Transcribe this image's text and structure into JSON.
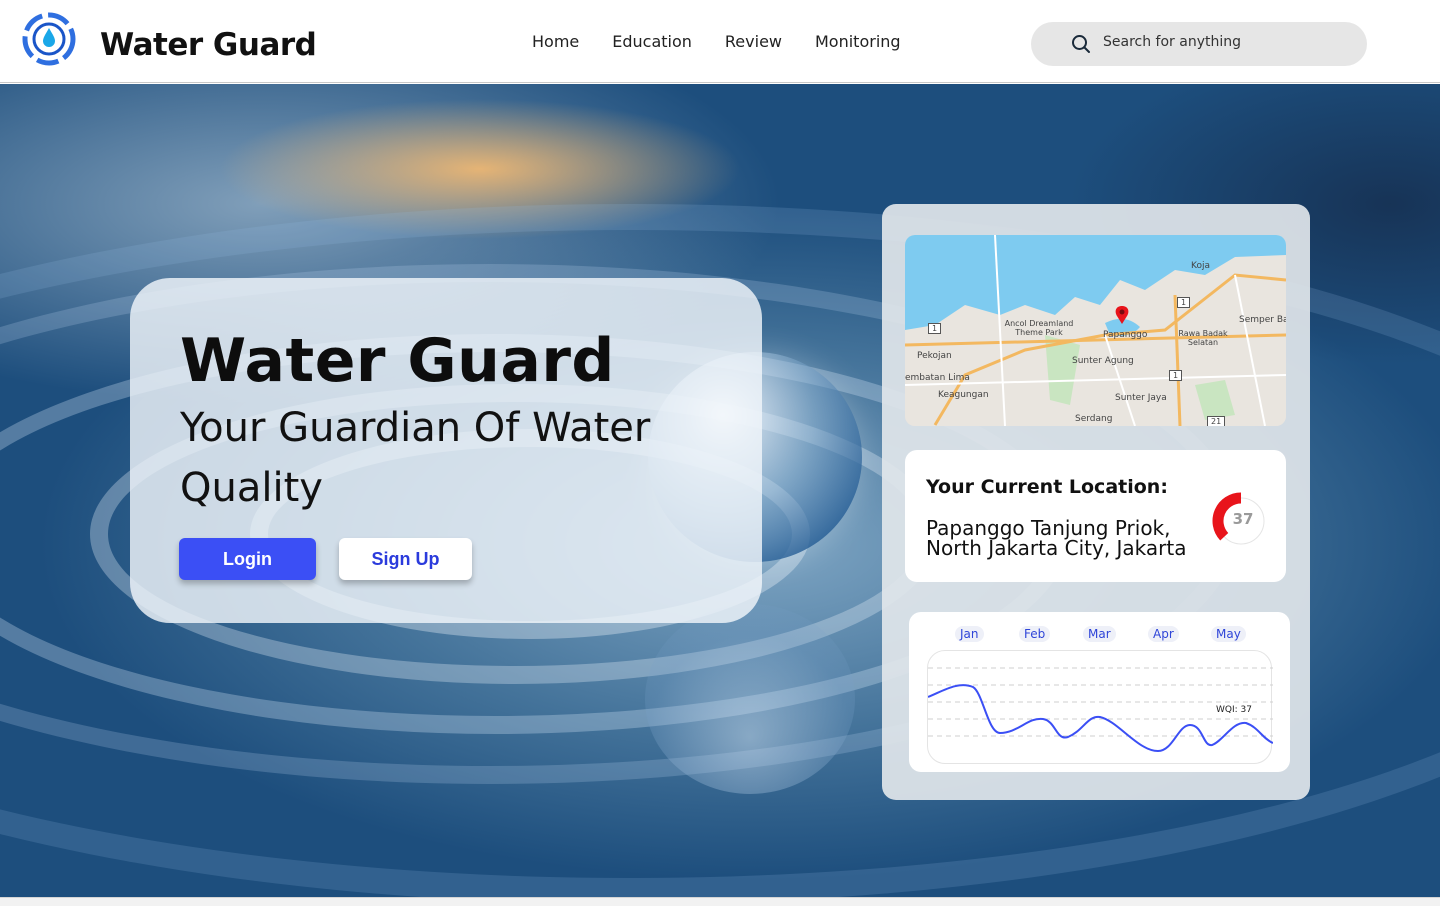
{
  "header": {
    "brand": "Water Guard",
    "nav": [
      {
        "label": "Home"
      },
      {
        "label": "Education"
      },
      {
        "label": "Review"
      },
      {
        "label": "Monitoring"
      }
    ],
    "search": {
      "placeholder": "Search for anything"
    }
  },
  "hero": {
    "title": "Water Guard",
    "subtitle": "Your Guardian Of Water Quality",
    "login_label": "Login",
    "signup_label": "Sign Up"
  },
  "panel": {
    "map": {
      "labels": [
        "Koja",
        "Semper Ba",
        "Ancol Dreamland Theme Park",
        "Papanggo",
        "Rawa Badak Selatan",
        "Pekojan",
        "Sunter Agung",
        "embatan Lima",
        "Keagungan",
        "Sunter Jaya",
        "Serdang"
      ],
      "road_shields": [
        "1",
        "1",
        "1",
        "21"
      ],
      "pin_color": "#e8141b"
    },
    "location": {
      "title": "Your Current Location:",
      "line1": "Papanggo Tanjung Priok,",
      "line2": "North Jakarta City, Jakarta",
      "wqi_value": "37",
      "gauge_color": "#e8141b"
    },
    "trend": {
      "months": [
        "Jan",
        "Feb",
        "Mar",
        "Apr",
        "May"
      ],
      "wqi_label": "WQI: 37",
      "line_color": "#3b4ff5"
    }
  },
  "colors": {
    "accent": "#3b4ff5",
    "signup_text": "#2b3bdc"
  }
}
